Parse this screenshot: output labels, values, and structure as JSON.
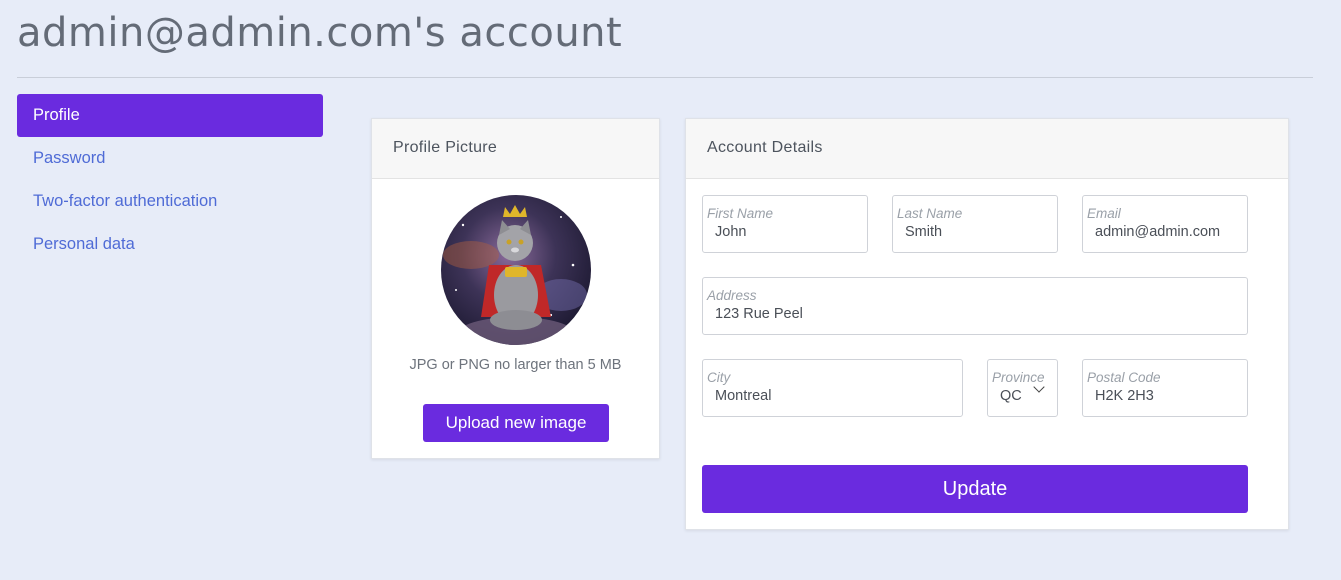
{
  "page": {
    "title": "admin@admin.com's account"
  },
  "sidebar": {
    "items": [
      {
        "label": "Profile",
        "active": true
      },
      {
        "label": "Password"
      },
      {
        "label": "Two-factor authentication"
      },
      {
        "label": "Personal data"
      }
    ]
  },
  "profile_picture": {
    "title": "Profile Picture",
    "image_icon": "cat-avatar",
    "hint": "JPG or PNG no larger than 5 MB",
    "upload_label": "Upload new image"
  },
  "account_details": {
    "title": "Account Details",
    "first_name": {
      "label": "First Name",
      "value": "John"
    },
    "last_name": {
      "label": "Last Name",
      "value": "Smith"
    },
    "email": {
      "label": "Email",
      "value": "admin@admin.com"
    },
    "address": {
      "label": "Address",
      "value": "123 Rue Peel"
    },
    "city": {
      "label": "City",
      "value": "Montreal"
    },
    "province": {
      "label": "Province",
      "value": "QC"
    },
    "postal_code": {
      "label": "Postal Code",
      "value": "H2K 2H3"
    },
    "update_label": "Update"
  },
  "colors": {
    "accent": "#6a2bdf",
    "link": "#4f6bd6",
    "background": "#e7ecf8"
  }
}
